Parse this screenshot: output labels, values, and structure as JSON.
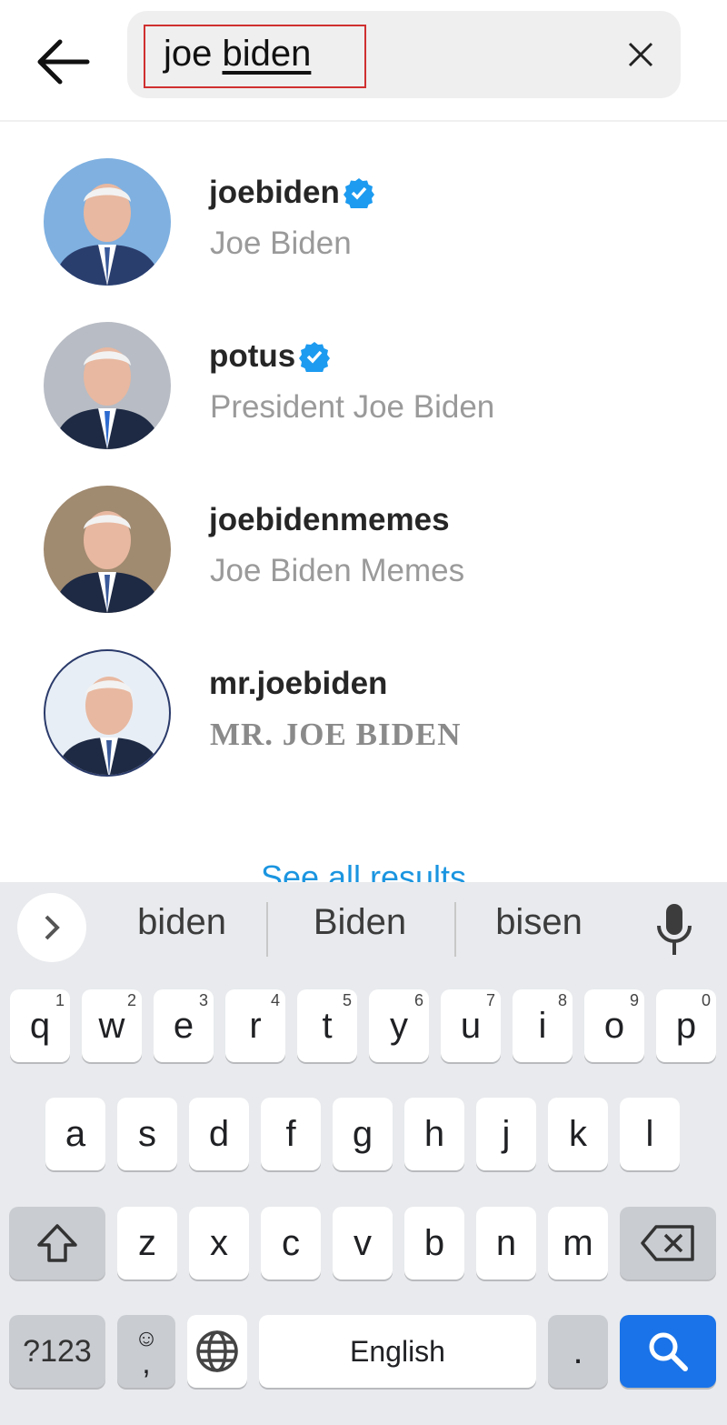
{
  "search": {
    "query_plain": "joe ",
    "query_composing": "biden"
  },
  "results": [
    {
      "username": "joebiden",
      "name": "Joe Biden",
      "verified": true,
      "avatar_bg": "#7fb0e0"
    },
    {
      "username": "potus",
      "name": "President Joe Biden",
      "verified": true,
      "avatar_bg": "#b8bcc4"
    },
    {
      "username": "joebidenmemes",
      "name": "Joe Biden Memes",
      "verified": false,
      "avatar_bg": "#a08a70"
    },
    {
      "username": "mr.joebiden",
      "name": "MR. JOE BIDEN",
      "verified": false,
      "avatar_bg": "#e8eef5"
    }
  ],
  "see_all": "See all results",
  "keyboard": {
    "suggestions": [
      "biden",
      "Biden",
      "bisen"
    ],
    "row1": [
      {
        "k": "q",
        "n": "1"
      },
      {
        "k": "w",
        "n": "2"
      },
      {
        "k": "e",
        "n": "3"
      },
      {
        "k": "r",
        "n": "4"
      },
      {
        "k": "t",
        "n": "5"
      },
      {
        "k": "y",
        "n": "6"
      },
      {
        "k": "u",
        "n": "7"
      },
      {
        "k": "i",
        "n": "8"
      },
      {
        "k": "o",
        "n": "9"
      },
      {
        "k": "p",
        "n": "0"
      }
    ],
    "row2": [
      "a",
      "s",
      "d",
      "f",
      "g",
      "h",
      "j",
      "k",
      "l"
    ],
    "row3": [
      "z",
      "x",
      "c",
      "v",
      "b",
      "n",
      "m"
    ],
    "symbols": "?123",
    "comma": ",",
    "space": "English",
    "period": ".",
    "accent": "#1a73e8"
  },
  "colors": {
    "verified": "#1d9bf0",
    "link": "#1b95e0"
  }
}
